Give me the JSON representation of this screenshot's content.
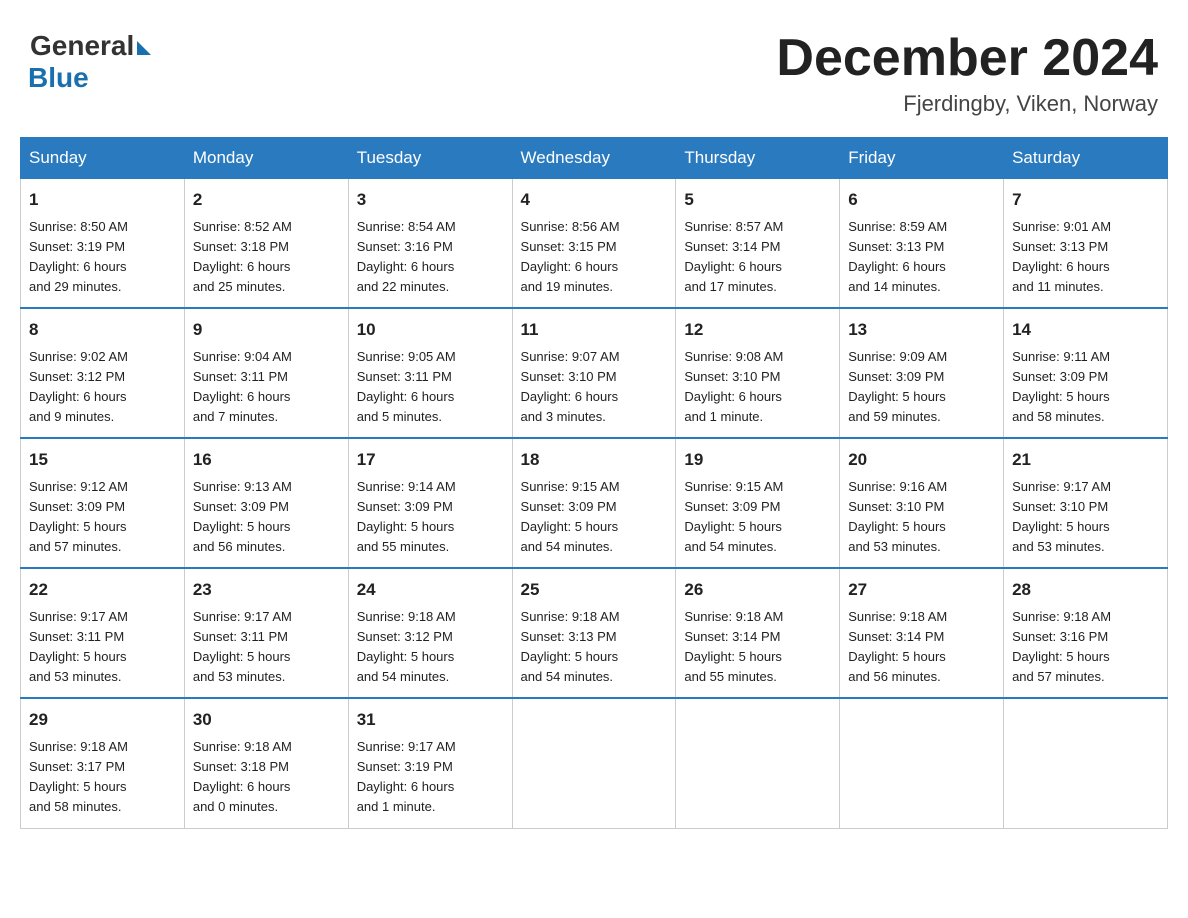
{
  "header": {
    "logo_general": "General",
    "logo_blue": "Blue",
    "month_title": "December 2024",
    "location": "Fjerdingby, Viken, Norway"
  },
  "weekdays": [
    "Sunday",
    "Monday",
    "Tuesday",
    "Wednesday",
    "Thursday",
    "Friday",
    "Saturday"
  ],
  "weeks": [
    [
      {
        "day": "1",
        "sunrise": "Sunrise: 8:50 AM",
        "sunset": "Sunset: 3:19 PM",
        "daylight": "Daylight: 6 hours",
        "daylight2": "and 29 minutes."
      },
      {
        "day": "2",
        "sunrise": "Sunrise: 8:52 AM",
        "sunset": "Sunset: 3:18 PM",
        "daylight": "Daylight: 6 hours",
        "daylight2": "and 25 minutes."
      },
      {
        "day": "3",
        "sunrise": "Sunrise: 8:54 AM",
        "sunset": "Sunset: 3:16 PM",
        "daylight": "Daylight: 6 hours",
        "daylight2": "and 22 minutes."
      },
      {
        "day": "4",
        "sunrise": "Sunrise: 8:56 AM",
        "sunset": "Sunset: 3:15 PM",
        "daylight": "Daylight: 6 hours",
        "daylight2": "and 19 minutes."
      },
      {
        "day": "5",
        "sunrise": "Sunrise: 8:57 AM",
        "sunset": "Sunset: 3:14 PM",
        "daylight": "Daylight: 6 hours",
        "daylight2": "and 17 minutes."
      },
      {
        "day": "6",
        "sunrise": "Sunrise: 8:59 AM",
        "sunset": "Sunset: 3:13 PM",
        "daylight": "Daylight: 6 hours",
        "daylight2": "and 14 minutes."
      },
      {
        "day": "7",
        "sunrise": "Sunrise: 9:01 AM",
        "sunset": "Sunset: 3:13 PM",
        "daylight": "Daylight: 6 hours",
        "daylight2": "and 11 minutes."
      }
    ],
    [
      {
        "day": "8",
        "sunrise": "Sunrise: 9:02 AM",
        "sunset": "Sunset: 3:12 PM",
        "daylight": "Daylight: 6 hours",
        "daylight2": "and 9 minutes."
      },
      {
        "day": "9",
        "sunrise": "Sunrise: 9:04 AM",
        "sunset": "Sunset: 3:11 PM",
        "daylight": "Daylight: 6 hours",
        "daylight2": "and 7 minutes."
      },
      {
        "day": "10",
        "sunrise": "Sunrise: 9:05 AM",
        "sunset": "Sunset: 3:11 PM",
        "daylight": "Daylight: 6 hours",
        "daylight2": "and 5 minutes."
      },
      {
        "day": "11",
        "sunrise": "Sunrise: 9:07 AM",
        "sunset": "Sunset: 3:10 PM",
        "daylight": "Daylight: 6 hours",
        "daylight2": "and 3 minutes."
      },
      {
        "day": "12",
        "sunrise": "Sunrise: 9:08 AM",
        "sunset": "Sunset: 3:10 PM",
        "daylight": "Daylight: 6 hours",
        "daylight2": "and 1 minute."
      },
      {
        "day": "13",
        "sunrise": "Sunrise: 9:09 AM",
        "sunset": "Sunset: 3:09 PM",
        "daylight": "Daylight: 5 hours",
        "daylight2": "and 59 minutes."
      },
      {
        "day": "14",
        "sunrise": "Sunrise: 9:11 AM",
        "sunset": "Sunset: 3:09 PM",
        "daylight": "Daylight: 5 hours",
        "daylight2": "and 58 minutes."
      }
    ],
    [
      {
        "day": "15",
        "sunrise": "Sunrise: 9:12 AM",
        "sunset": "Sunset: 3:09 PM",
        "daylight": "Daylight: 5 hours",
        "daylight2": "and 57 minutes."
      },
      {
        "day": "16",
        "sunrise": "Sunrise: 9:13 AM",
        "sunset": "Sunset: 3:09 PM",
        "daylight": "Daylight: 5 hours",
        "daylight2": "and 56 minutes."
      },
      {
        "day": "17",
        "sunrise": "Sunrise: 9:14 AM",
        "sunset": "Sunset: 3:09 PM",
        "daylight": "Daylight: 5 hours",
        "daylight2": "and 55 minutes."
      },
      {
        "day": "18",
        "sunrise": "Sunrise: 9:15 AM",
        "sunset": "Sunset: 3:09 PM",
        "daylight": "Daylight: 5 hours",
        "daylight2": "and 54 minutes."
      },
      {
        "day": "19",
        "sunrise": "Sunrise: 9:15 AM",
        "sunset": "Sunset: 3:09 PM",
        "daylight": "Daylight: 5 hours",
        "daylight2": "and 54 minutes."
      },
      {
        "day": "20",
        "sunrise": "Sunrise: 9:16 AM",
        "sunset": "Sunset: 3:10 PM",
        "daylight": "Daylight: 5 hours",
        "daylight2": "and 53 minutes."
      },
      {
        "day": "21",
        "sunrise": "Sunrise: 9:17 AM",
        "sunset": "Sunset: 3:10 PM",
        "daylight": "Daylight: 5 hours",
        "daylight2": "and 53 minutes."
      }
    ],
    [
      {
        "day": "22",
        "sunrise": "Sunrise: 9:17 AM",
        "sunset": "Sunset: 3:11 PM",
        "daylight": "Daylight: 5 hours",
        "daylight2": "and 53 minutes."
      },
      {
        "day": "23",
        "sunrise": "Sunrise: 9:17 AM",
        "sunset": "Sunset: 3:11 PM",
        "daylight": "Daylight: 5 hours",
        "daylight2": "and 53 minutes."
      },
      {
        "day": "24",
        "sunrise": "Sunrise: 9:18 AM",
        "sunset": "Sunset: 3:12 PM",
        "daylight": "Daylight: 5 hours",
        "daylight2": "and 54 minutes."
      },
      {
        "day": "25",
        "sunrise": "Sunrise: 9:18 AM",
        "sunset": "Sunset: 3:13 PM",
        "daylight": "Daylight: 5 hours",
        "daylight2": "and 54 minutes."
      },
      {
        "day": "26",
        "sunrise": "Sunrise: 9:18 AM",
        "sunset": "Sunset: 3:14 PM",
        "daylight": "Daylight: 5 hours",
        "daylight2": "and 55 minutes."
      },
      {
        "day": "27",
        "sunrise": "Sunrise: 9:18 AM",
        "sunset": "Sunset: 3:14 PM",
        "daylight": "Daylight: 5 hours",
        "daylight2": "and 56 minutes."
      },
      {
        "day": "28",
        "sunrise": "Sunrise: 9:18 AM",
        "sunset": "Sunset: 3:16 PM",
        "daylight": "Daylight: 5 hours",
        "daylight2": "and 57 minutes."
      }
    ],
    [
      {
        "day": "29",
        "sunrise": "Sunrise: 9:18 AM",
        "sunset": "Sunset: 3:17 PM",
        "daylight": "Daylight: 5 hours",
        "daylight2": "and 58 minutes."
      },
      {
        "day": "30",
        "sunrise": "Sunrise: 9:18 AM",
        "sunset": "Sunset: 3:18 PM",
        "daylight": "Daylight: 6 hours",
        "daylight2": "and 0 minutes."
      },
      {
        "day": "31",
        "sunrise": "Sunrise: 9:17 AM",
        "sunset": "Sunset: 3:19 PM",
        "daylight": "Daylight: 6 hours",
        "daylight2": "and 1 minute."
      },
      null,
      null,
      null,
      null
    ]
  ]
}
